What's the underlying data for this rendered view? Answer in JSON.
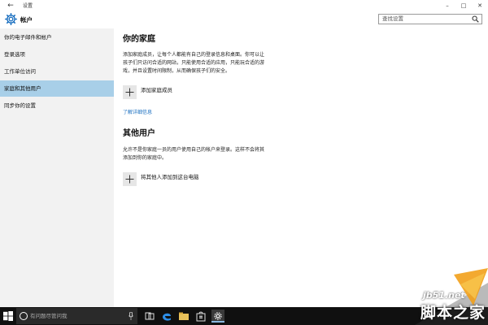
{
  "window": {
    "back_glyph": "←",
    "title": "设置",
    "minimize_glyph": "–",
    "maximize_glyph": "□",
    "close_glyph": "✕"
  },
  "header": {
    "icon": "gear-icon",
    "title": "帐户",
    "search_placeholder": "查找设置",
    "accent": "#1a6fc0"
  },
  "sidebar": {
    "items": [
      {
        "label": "你的电子邮件和帐户",
        "selected": false
      },
      {
        "label": "登录选项",
        "selected": false
      },
      {
        "label": "工作单位访问",
        "selected": false
      },
      {
        "label": "家庭和其他用户",
        "selected": true
      },
      {
        "label": "同步你的设置",
        "selected": false
      }
    ],
    "selected_color": "#a8cfe8"
  },
  "main": {
    "family": {
      "heading": "你的家庭",
      "description_lines": [
        "添加家庭成员，让每个人都能有自己的登录信息和桌面。你可以让",
        "孩子们只访问合适的网站，只能使用合适的应用，只能玩合适的游",
        "戏，并且设置时间限制，从而确保孩子们的安全。"
      ],
      "add_label": "添加家庭成员",
      "learn_more": "了解详细信息"
    },
    "others": {
      "heading": "其他用户",
      "description_lines": [
        "允许不是你家庭一员的用户使用自己的帐户来登录。这样不会将其",
        "添加到你的家庭中。"
      ],
      "add_label": "将其他人添加到这台电脑"
    }
  },
  "taskbar": {
    "search_placeholder": "有问题尽管问我",
    "icons": [
      "windows-start-icon",
      "cortana-icon",
      "microphone-icon",
      "task-view-icon",
      "edge-browser-icon",
      "file-explorer-icon",
      "store-icon",
      "settings-icon"
    ]
  },
  "watermark": {
    "domain": "jb51.net",
    "brand": "脚本之家"
  }
}
